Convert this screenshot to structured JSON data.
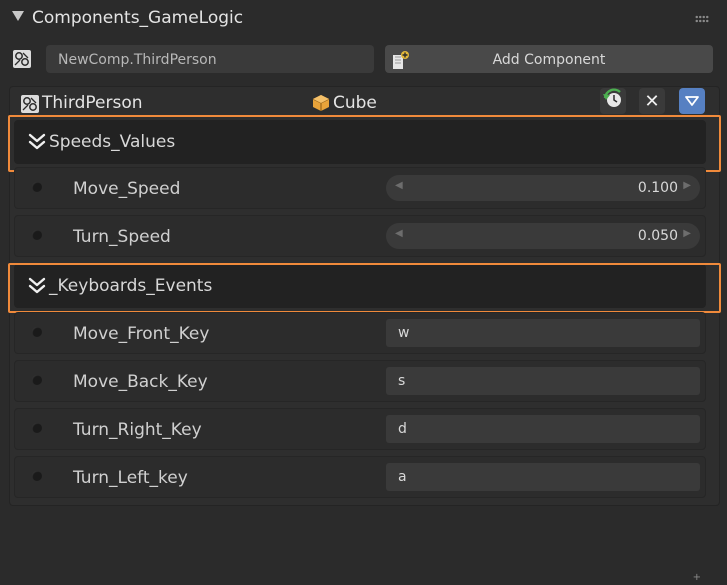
{
  "panel": {
    "title": "Components_GameLogic"
  },
  "toolbar": {
    "component_name_value": "NewComp.ThirdPerson",
    "add_component_label": "Add Component"
  },
  "component": {
    "name": "ThirdPerson",
    "object": "Cube",
    "sections": [
      {
        "label": "Speeds_Values",
        "props": [
          {
            "label": "Move_Speed",
            "value": "0.100"
          },
          {
            "label": "Turn_Speed",
            "value": "0.050"
          }
        ]
      },
      {
        "label": "_Keyboards_Events",
        "props": [
          {
            "label": "Move_Front_Key",
            "value": "w"
          },
          {
            "label": "Move_Back_Key",
            "value": "s"
          },
          {
            "label": "Turn_Right_Key",
            "value": "d"
          },
          {
            "label": "Turn_Left_key",
            "value": "a"
          }
        ]
      }
    ]
  },
  "icons": {
    "collapse": "triangle-down-icon",
    "drag": "drag-dots-icon",
    "component": "component-icon",
    "add": "add-component-icon",
    "cube": "cube-icon",
    "reload": "reload-icon",
    "close": "close-icon",
    "menu": "menu-dropdown-icon",
    "section": "double-chevron-down-icon"
  },
  "colors": {
    "highlight": "#f08a3b",
    "accent": "#5680c2",
    "cube": "#e8a33a",
    "reload": "#4caf50"
  }
}
